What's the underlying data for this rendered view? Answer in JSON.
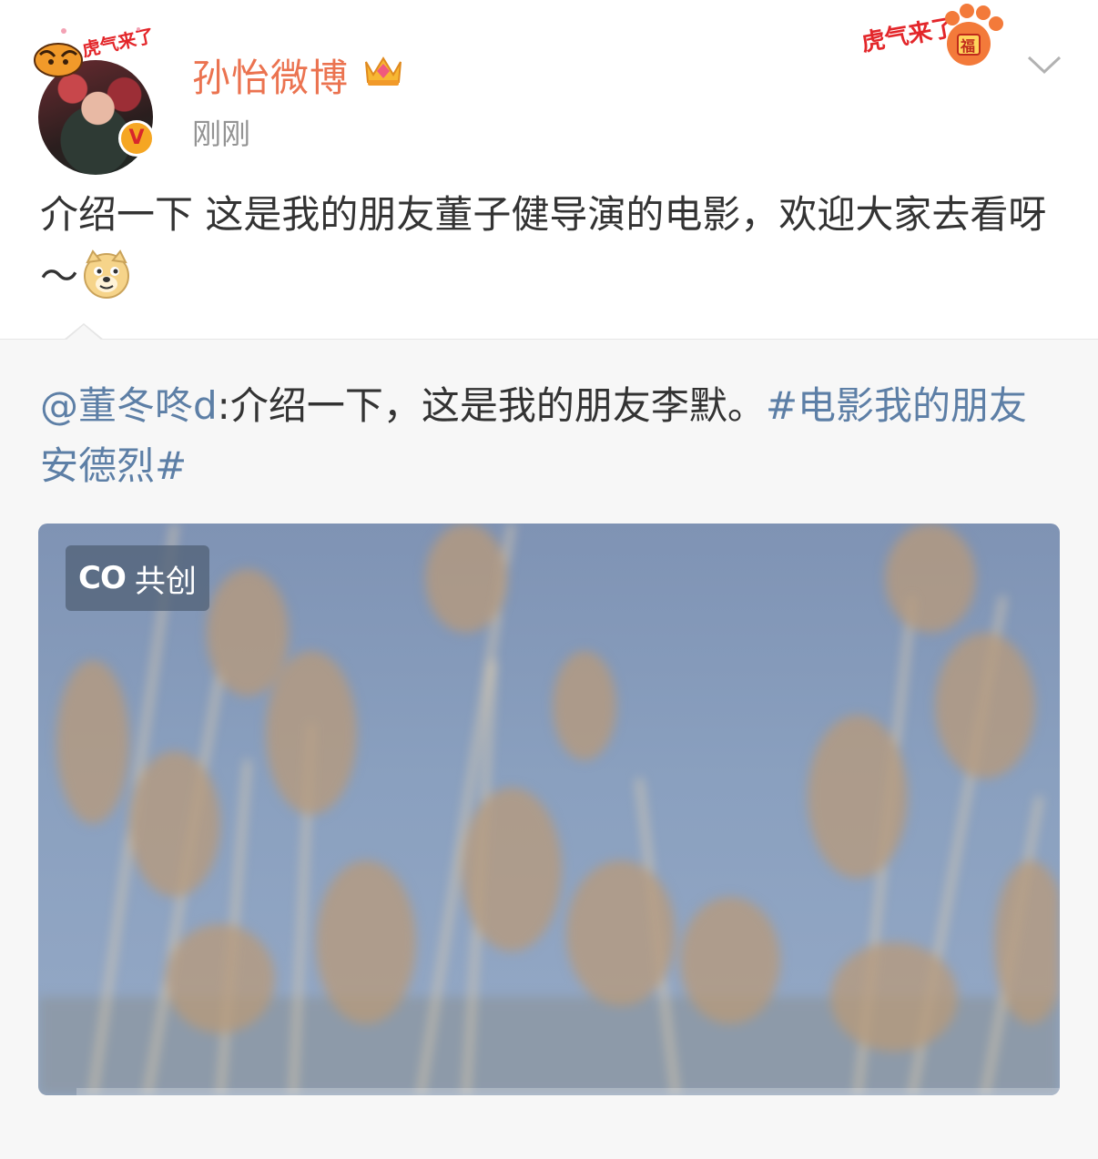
{
  "post": {
    "username": "孙怡微博",
    "timestamp": "刚刚",
    "text": "介绍一下 这是我的朋友董子健导演的电影，欢迎大家去看呀～",
    "avatar_frame_text": "虎气来了",
    "festive_badge_text": "虎气来了",
    "festive_badge_glyph": "福",
    "verified_mark": "V"
  },
  "repost": {
    "mention": "@董冬咚d",
    "separator": ":",
    "text": "介绍一下，这是我的朋友李默。",
    "topic": "#电影我的朋友安德烈#"
  },
  "video": {
    "badge_icon": "CO",
    "badge_label": "共创"
  },
  "colors": {
    "username": "#eb7350",
    "link": "#5d7fa6",
    "body_text": "#333333",
    "timestamp": "#939393"
  }
}
